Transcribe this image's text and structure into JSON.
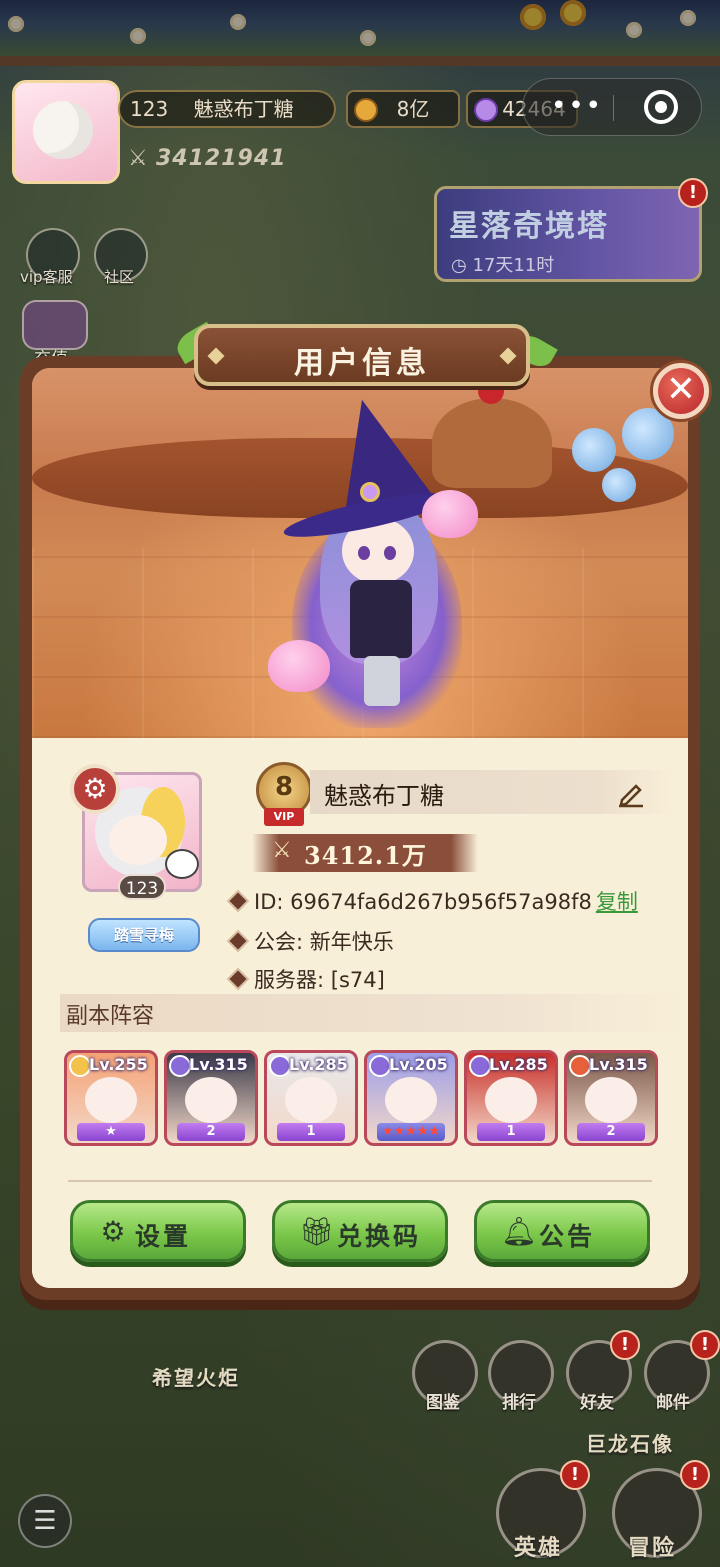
{
  "hud": {
    "player_level": "123",
    "player_name": "魅惑布丁糖",
    "gold": "8亿",
    "gems": "42464",
    "power": "34121941",
    "vip_service_label": "vip客服",
    "community_label": "社区",
    "recharge_label": "充值"
  },
  "event_banner": {
    "title": "星落奇境塔",
    "timer": "17天11时"
  },
  "modal": {
    "title": "用户信息",
    "close_glyph": "✕",
    "vip_level": "8",
    "vip_tag": "VIP",
    "name": "魅惑布丁糖",
    "power": "3412.1万",
    "avatar_level": "123",
    "avatar_title": "踏雪寻梅",
    "id_label": "ID: ",
    "id_value": "69674fa6d267b956f57a98f8",
    "copy_label": "复制",
    "guild_label": "公会: ",
    "guild_value": "新年快乐",
    "server_label": "服务器: ",
    "server_value": "[s74]",
    "lineup_title": "副本阵容",
    "heroes": [
      {
        "level": "Lv.255",
        "stars": "★",
        "element": "light",
        "color": "#f4a276"
      },
      {
        "level": "Lv.315",
        "stars": "2",
        "element": "dark",
        "color": "#3a3a48"
      },
      {
        "level": "Lv.285",
        "stars": "1",
        "element": "dark",
        "color": "#e8e8ea"
      },
      {
        "level": "Lv.205",
        "stars": "★★★★★",
        "element": "dark",
        "color": "#9c9ee8"
      },
      {
        "level": "Lv.285",
        "stars": "1",
        "element": "dark",
        "color": "#c8302a"
      },
      {
        "level": "Lv.315",
        "stars": "2",
        "element": "fire",
        "color": "#7a5848"
      }
    ],
    "buttons": {
      "settings": "设置",
      "redeem": "兑换码",
      "notice": "公告"
    }
  },
  "bottom": {
    "torch_label": "希望火炬",
    "dragon_label": "巨龙石像",
    "codex_label": "图鉴",
    "ranking_label": "排行",
    "friends_label": "好友",
    "mail_label": "邮件",
    "hero_label": "英雄",
    "adventure_label": "冒险"
  },
  "colors": {
    "modal_frame": "#6b3d26",
    "modal_bg": "#f8efd8",
    "button_green": "#7cc84a",
    "close_red": "#b8262a",
    "copy_green": "#3a9a3a"
  }
}
